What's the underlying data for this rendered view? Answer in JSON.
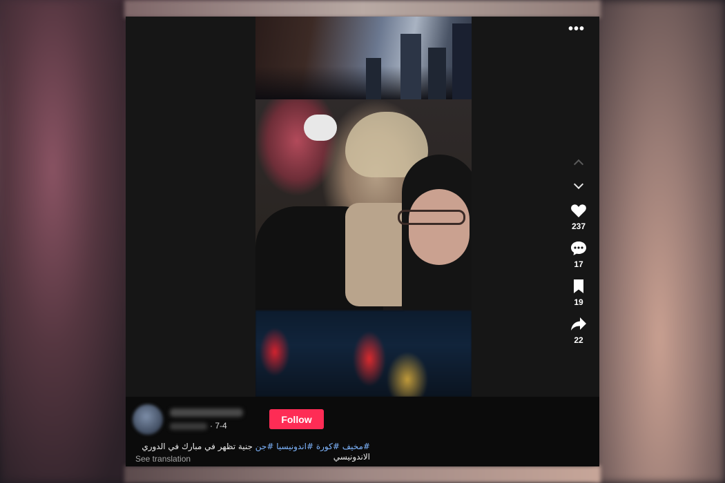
{
  "post": {
    "more_icon": "more-horizontal-icon",
    "nav": {
      "up_icon": "chevron-up-icon",
      "down_icon": "chevron-down-icon"
    },
    "actions": [
      {
        "name": "like",
        "icon": "heart-icon",
        "count": "237"
      },
      {
        "name": "comment",
        "icon": "comment-icon",
        "count": "17"
      },
      {
        "name": "save",
        "icon": "bookmark-icon",
        "count": "19"
      },
      {
        "name": "share",
        "icon": "share-arrow-icon",
        "count": "22"
      }
    ],
    "author": {
      "date": "· 7-4"
    },
    "follow_label": "Follow",
    "caption": {
      "line1_hashtags": [
        "#مخيف",
        "#كورة",
        "#اندونيسيا",
        "#جن"
      ],
      "line1_text": "جنية تظهر في مبارك في الدوري الاندونيسي"
    },
    "see_translation": "See translation"
  },
  "colors": {
    "follow_button": "#fe2c55",
    "hashtag": "#7fb6ff",
    "card_background": "#161616"
  }
}
